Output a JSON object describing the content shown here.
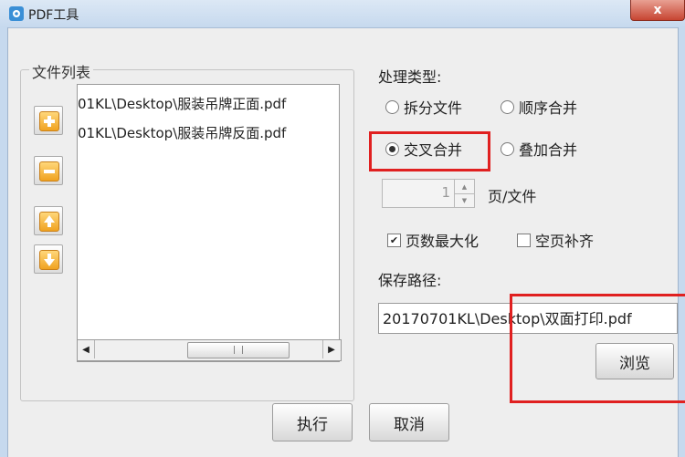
{
  "window": {
    "title": "PDF工具",
    "close_glyph": "x",
    "app_icon": "gear-icon"
  },
  "file_list": {
    "legend": "文件列表",
    "items": [
      "01KL\\Desktop\\服装吊牌正面.pdf",
      "01KL\\Desktop\\服装吊牌反面.pdf"
    ],
    "scroll_left": "◀",
    "scroll_right": "▶",
    "side_buttons": [
      "add-icon",
      "remove-icon",
      "move-up-icon",
      "move-down-icon"
    ]
  },
  "process": {
    "label": "处理类型:",
    "options": [
      {
        "label": "拆分文件",
        "selected": false
      },
      {
        "label": "顺序合并",
        "selected": false
      },
      {
        "label": "交叉合并",
        "selected": true
      },
      {
        "label": "叠加合并",
        "selected": false
      }
    ]
  },
  "pages_per_file": {
    "value": "1",
    "unit": "页/文件"
  },
  "checkboxes": [
    {
      "label": "页数最大化",
      "checked": true
    },
    {
      "label": "空页补齐",
      "checked": false
    }
  ],
  "save_path": {
    "label": "保存路径:",
    "value": "20170701KL\\Desktop\\双面打印.pdf",
    "browse": "浏览"
  },
  "actions": {
    "execute": "执行",
    "cancel": "取消"
  },
  "colors": {
    "highlight": "#e02020",
    "background": "#eeeeee"
  }
}
